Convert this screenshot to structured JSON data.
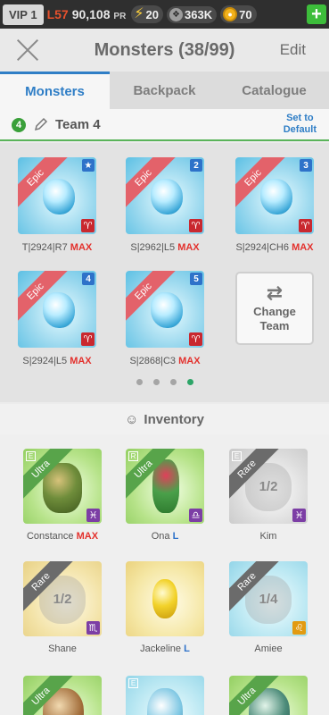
{
  "status": {
    "vip": "VIP 1",
    "level": "L57",
    "power": "90,108",
    "power_unit": "PR",
    "energy": "20",
    "food": "363K",
    "gold": "70",
    "add_label": "+"
  },
  "header": {
    "title": "Monsters (38/99)",
    "edit_label": "Edit"
  },
  "tabs": [
    {
      "label": "Monsters",
      "active": true
    },
    {
      "label": "Backpack",
      "active": false
    },
    {
      "label": "Catalogue",
      "active": false
    }
  ],
  "team": {
    "number": "4",
    "name": "Team 4",
    "set_default_line1": "Set to",
    "set_default_line2": "Default",
    "slots": [
      {
        "rarity": "Epic",
        "badge": "★",
        "sign": "♈",
        "label": "T|2924|R7",
        "max": "MAX"
      },
      {
        "rarity": "Epic",
        "badge": "2",
        "sign": "♈",
        "label": "S|2962|L5",
        "max": "MAX"
      },
      {
        "rarity": "Epic",
        "badge": "3",
        "sign": "♈",
        "label": "S|2924|CH6",
        "max": "MAX"
      },
      {
        "rarity": "Epic",
        "badge": "4",
        "sign": "♈",
        "label": "S|2924|L5",
        "max": "MAX"
      },
      {
        "rarity": "Epic",
        "badge": "5",
        "sign": "♈",
        "label": "S|2868|C3",
        "max": "MAX"
      }
    ],
    "change_team_line1": "Change",
    "change_team_line2": "Team",
    "page_dots": 4,
    "active_dot": 4
  },
  "inventory": {
    "title": "Inventory",
    "items": [
      {
        "name": "Constance",
        "suffix": "MAX",
        "rarity": "Ultra",
        "sign": "♓"
      },
      {
        "name": "Ona",
        "suffix": "L",
        "rarity": "Ultra",
        "sign": "♎"
      },
      {
        "name": "Kim",
        "suffix": "",
        "rarity": "Rare",
        "fraction": "1/2",
        "sign": "♓"
      },
      {
        "name": "Shane",
        "suffix": "",
        "rarity": "Rare",
        "fraction": "1/2",
        "sign": "♏"
      },
      {
        "name": "Jackeline",
        "suffix": "L",
        "rarity": "",
        "sign": ""
      },
      {
        "name": "Amiee",
        "suffix": "",
        "rarity": "Rare",
        "fraction": "1/4",
        "sign": "♌"
      },
      {
        "rarity": "Ultra"
      },
      {
        "rarity": ""
      },
      {
        "rarity": "Ultra"
      }
    ]
  },
  "colors": {
    "accent_blue": "#2f7ec6",
    "max_red": "#e3312d",
    "epic_ribbon": "#e3626a",
    "ultra_ribbon": "#58a44a",
    "rare_ribbon": "#6b6b6b",
    "active_dot": "#2da568"
  }
}
